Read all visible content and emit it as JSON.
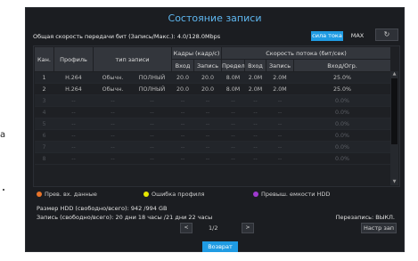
{
  "outside": {
    "left_char": "a"
  },
  "title": "Состояние записи",
  "rate_label": "Общая скорость передачи бит (Запись/Макс.): 4.0/128.0Mbps",
  "buttons": {
    "power": "сила тока",
    "max": "MAX",
    "refresh_icon": "refresh-icon",
    "settings": "Настр зап",
    "back": "Возврат"
  },
  "table": {
    "headers": {
      "channel": "Кан.",
      "profile": "Профиль",
      "rec_type": "тип записи",
      "frames": "Кадры (кадр/с)",
      "bitrate": "Скорость потока (бит/сек)",
      "input": "Вход",
      "record": "Запись",
      "limit": "Предел",
      "input2": "Вход",
      "record2": "Запись",
      "in_limit": "Вход/Огр."
    },
    "rows": [
      {
        "ch": "1",
        "profile": "H.264",
        "type": "Обычн.",
        "type2": "ПОЛНЫЙ",
        "fin": "20.0",
        "frec": "20.0",
        "lim": "8.0M",
        "bin": "2.0M",
        "brec": "2.0M",
        "pct": "25.0%"
      },
      {
        "ch": "2",
        "profile": "H.264",
        "type": "Обычн.",
        "type2": "ПОЛНЫЙ",
        "fin": "20.0",
        "frec": "20.0",
        "lim": "8.0M",
        "bin": "2.0M",
        "brec": "2.0M",
        "pct": "25.0%"
      },
      {
        "ch": "3",
        "profile": "--",
        "type": "--",
        "type2": "--",
        "fin": "--",
        "frec": "--",
        "lim": "--",
        "bin": "--",
        "brec": "--",
        "pct": "0.0%"
      },
      {
        "ch": "4",
        "profile": "--",
        "type": "--",
        "type2": "--",
        "fin": "--",
        "frec": "--",
        "lim": "--",
        "bin": "--",
        "brec": "--",
        "pct": "0.0%"
      },
      {
        "ch": "5",
        "profile": "--",
        "type": "--",
        "type2": "--",
        "fin": "--",
        "frec": "--",
        "lim": "--",
        "bin": "--",
        "brec": "--",
        "pct": "0.0%"
      },
      {
        "ch": "6",
        "profile": "--",
        "type": "--",
        "type2": "--",
        "fin": "--",
        "frec": "--",
        "lim": "--",
        "bin": "--",
        "brec": "--",
        "pct": "0.0%"
      },
      {
        "ch": "7",
        "profile": "--",
        "type": "--",
        "type2": "--",
        "fin": "--",
        "frec": "--",
        "lim": "--",
        "bin": "--",
        "brec": "--",
        "pct": "0.0%"
      },
      {
        "ch": "8",
        "profile": "--",
        "type": "--",
        "type2": "--",
        "fin": "--",
        "frec": "--",
        "lim": "--",
        "bin": "--",
        "brec": "--",
        "pct": "0.0%"
      }
    ]
  },
  "legend": [
    {
      "label": "Прев. вх. данные",
      "color": "#e8742a"
    },
    {
      "label": "Ошибка профиля",
      "color": "#e6e600"
    },
    {
      "label": "Превыш. емкости HDD",
      "color": "#a03ad0"
    }
  ],
  "hdd": "Размер HDD (свободно/всего):  942 /994 GB",
  "record_time": "Запись (свободно/всего):  20 дни 18 часы  /21 дни 22 часы",
  "overwrite": "Перезапись:  ВЫКЛ.",
  "pager": {
    "prev": "<",
    "next": ">",
    "page": "1/2"
  }
}
